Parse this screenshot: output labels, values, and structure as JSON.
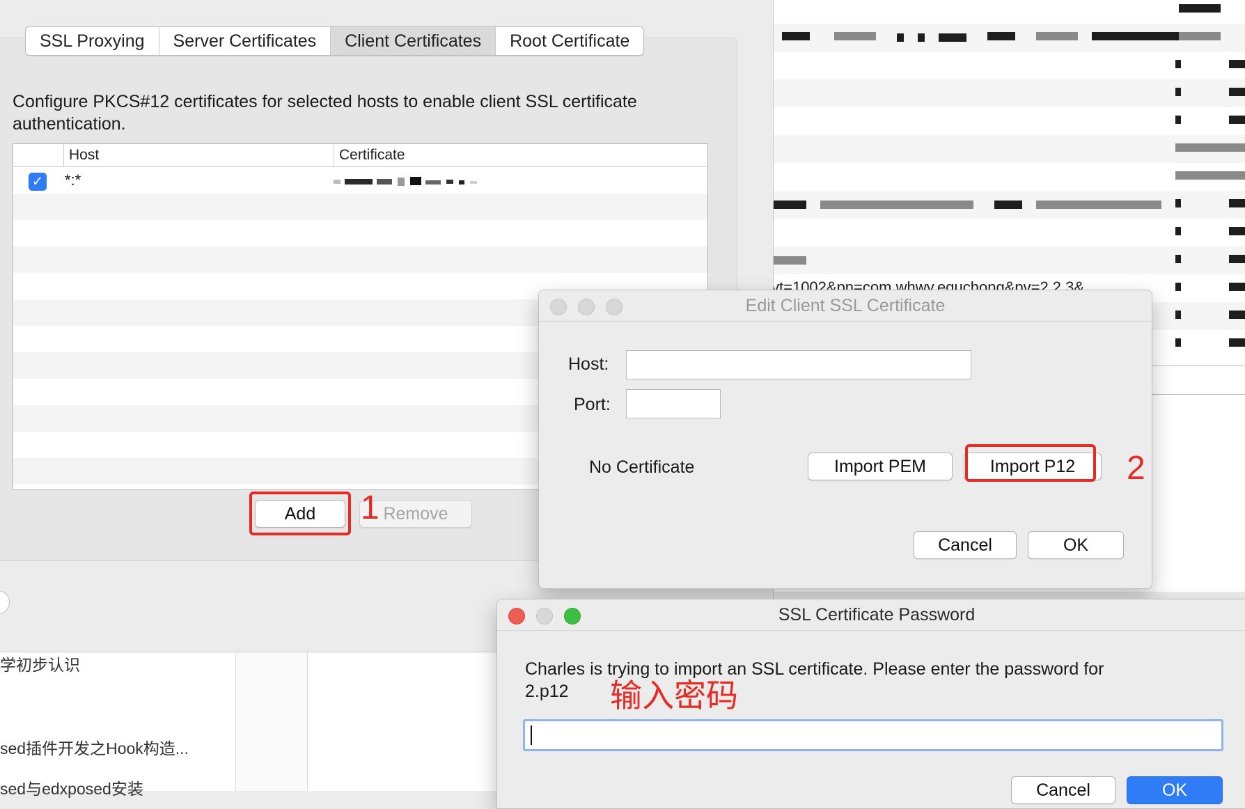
{
  "main_window": {
    "tabs": [
      {
        "label": "SSL Proxying",
        "active": false
      },
      {
        "label": "Server Certificates",
        "active": false
      },
      {
        "label": "Client Certificates",
        "active": true
      },
      {
        "label": "Root Certificate",
        "active": false
      }
    ],
    "description": "Configure PKCS#12 certificates for selected hosts to enable client SSL certificate authentication.",
    "table": {
      "columns": [
        "Host",
        "Certificate"
      ],
      "rows": [
        {
          "enabled": true,
          "host": "*:*",
          "certificate": ""
        }
      ]
    },
    "add_label": "Add",
    "remove_label": "Remove"
  },
  "edit_dialog": {
    "title": "Edit Client SSL Certificate",
    "host_label": "Host:",
    "host_value": "",
    "port_label": "Port:",
    "port_value": "",
    "no_certificate": "No Certificate",
    "import_pem": "Import PEM",
    "import_p12": "Import P12",
    "cancel": "Cancel",
    "ok": "OK"
  },
  "password_dialog": {
    "title": "SSL Certificate Password",
    "message": "Charles is trying to import an SSL certificate. Please enter the password for 2.p12",
    "password_value": "",
    "cancel": "Cancel",
    "ok": "OK"
  },
  "annotations": {
    "step1": "1",
    "step2": "2",
    "hint": "输入密码",
    "color": "#e52b24"
  },
  "background": {
    "url_fragment": "vt=1002&pn=com.whwy.equchong&pv=2.2.3&...",
    "blog_items": [
      "学初步认识",
      "sed插件开发之Hook构造...",
      "sed与edxposed安装"
    ]
  },
  "colors": {
    "accent": "#2f7cf6",
    "annotation_red": "#e52b24"
  },
  "icons": {
    "checkbox": "checkmark-icon",
    "close": "close-icon",
    "minimize": "minimize-icon",
    "zoom": "zoom-icon"
  }
}
